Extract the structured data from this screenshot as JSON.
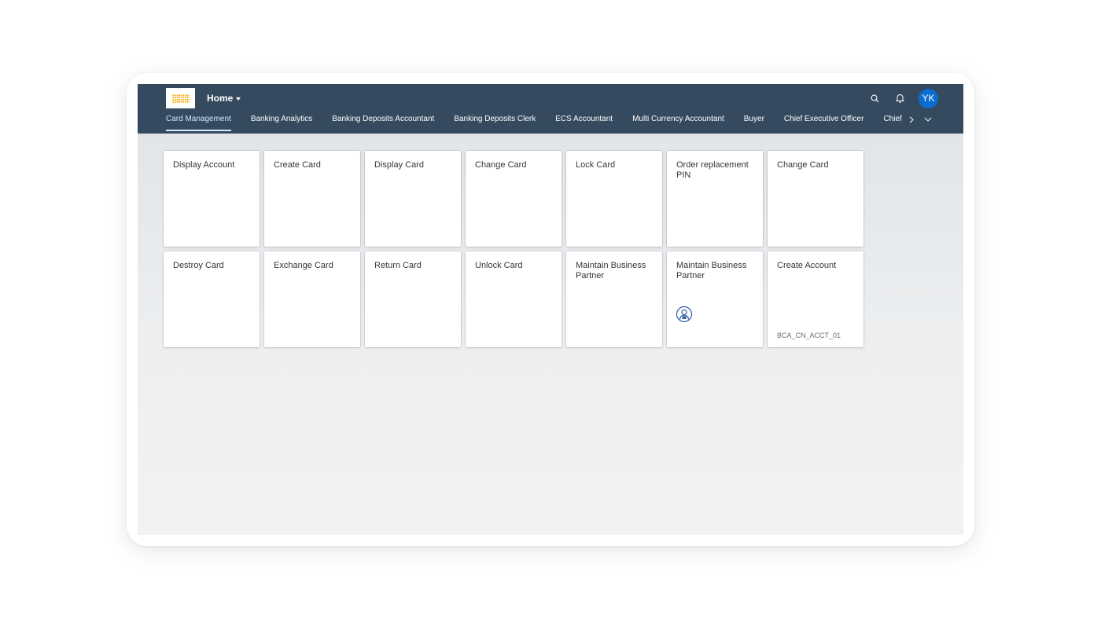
{
  "shell": {
    "home_label": "Home",
    "avatar_initials": "YK",
    "accent_color": "#0a6ed1",
    "bar_color": "#354a5f"
  },
  "tabs": [
    {
      "label": "Card Management",
      "active": true
    },
    {
      "label": "Banking Analytics"
    },
    {
      "label": "Banking Deposits Accountant"
    },
    {
      "label": "Banking Deposits Clerk"
    },
    {
      "label": "ECS Accountant"
    },
    {
      "label": "Multi Currency Accountant"
    },
    {
      "label": "Buyer"
    },
    {
      "label": "Chief Executive Officer"
    },
    {
      "label": "Chief Marke"
    }
  ],
  "tiles": [
    {
      "title": "Display Account"
    },
    {
      "title": "Create Card"
    },
    {
      "title": "Display Card"
    },
    {
      "title": "Change Card"
    },
    {
      "title": "Lock Card"
    },
    {
      "title": "Order replacement PIN"
    },
    {
      "title": "Change Card"
    },
    {
      "title": "Destroy Card"
    },
    {
      "title": "Exchange Card"
    },
    {
      "title": "Return Card"
    },
    {
      "title": "Unlock Card"
    },
    {
      "title": "Maintain Business Partner"
    },
    {
      "title": "Maintain Business Partner",
      "icon": "business-partner-icon"
    },
    {
      "title": "Create Account",
      "footer": "BCA_CN_ACCT_01"
    }
  ]
}
